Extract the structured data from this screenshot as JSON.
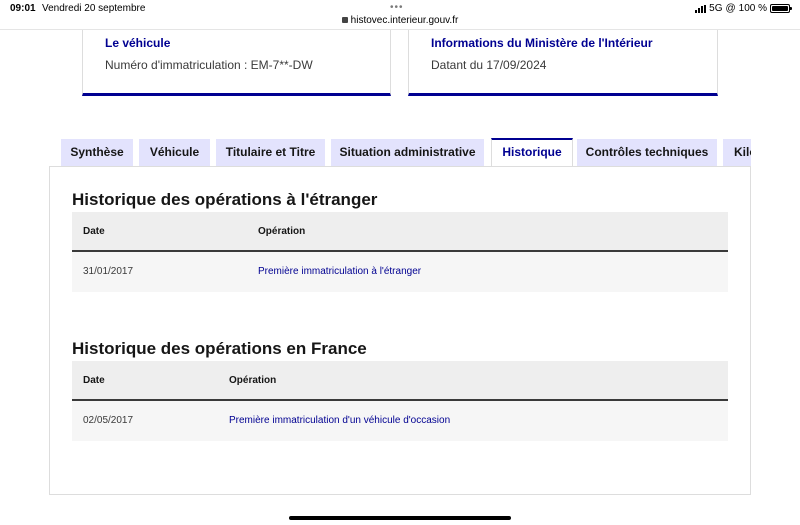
{
  "statusbar": {
    "time": "09:01",
    "date": "Vendredi 20 septembre",
    "url": "histovec.interieur.gouv.fr",
    "network": "5G",
    "battery": "100 %"
  },
  "cards": [
    {
      "title": "Le véhicule",
      "text": "Numéro d'immatriculation : EM-7**-DW"
    },
    {
      "title": "Informations du Ministère de l'Intérieur",
      "text": "Datant du 17/09/2024"
    }
  ],
  "tabs": [
    {
      "label": "Synthèse",
      "active": false
    },
    {
      "label": "Véhicule",
      "active": false
    },
    {
      "label": "Titulaire et Titre",
      "active": false
    },
    {
      "label": "Situation administrative",
      "active": false
    },
    {
      "label": "Historique",
      "active": true
    },
    {
      "label": "Contrôles techniques",
      "active": false
    },
    {
      "label": "Kilo",
      "active": false
    }
  ],
  "sections": [
    {
      "title": "Historique des opérations à l'étranger",
      "columns": [
        "Date",
        "Opération"
      ],
      "rows": [
        {
          "date": "31/01/2017",
          "operation": "Première immatriculation à l'étranger"
        }
      ]
    },
    {
      "title": "Historique des opérations en France",
      "columns": [
        "Date",
        "Opération"
      ],
      "rows": [
        {
          "date": "02/05/2017",
          "operation": "Première immatriculation d'un véhicule d'occasion"
        }
      ]
    }
  ],
  "colors": {
    "primary": "#000091",
    "tab_bg": "#e3e3fd"
  }
}
